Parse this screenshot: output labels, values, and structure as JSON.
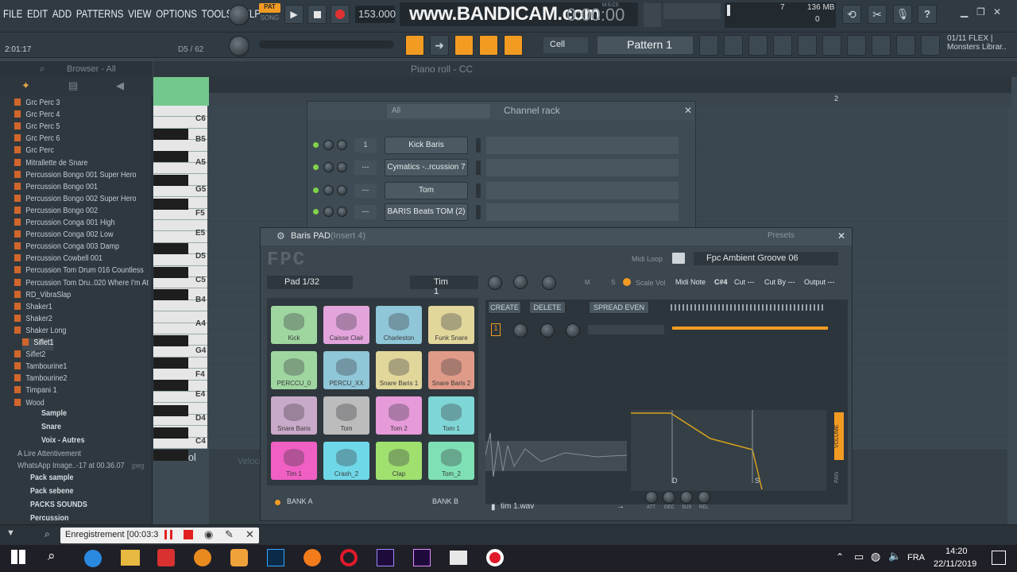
{
  "menu": [
    "FILE",
    "EDIT",
    "ADD",
    "PATTERNS",
    "VIEW",
    "OPTIONS",
    "TOOLS",
    "HELP"
  ],
  "transport": {
    "pat_label": "PAT",
    "song_label": "SONG",
    "tempo": "153.000",
    "time": "0:00:00",
    "mscs": "M:S:CS"
  },
  "watermark": "www.BANDICAM.com",
  "stats": {
    "cpu": "7",
    "mem": "136 MB",
    "poly": "0"
  },
  "hint": {
    "time": "2:01:17",
    "pos": "D5 / 62"
  },
  "toolbar": {
    "snap": "Cell",
    "pattern": "Pattern 1"
  },
  "news": {
    "line1": "01/11  FLEX |",
    "line2": "Monsters Librar.."
  },
  "browser": {
    "title": "Browser - All",
    "items": [
      "Grc Perc 3",
      "Grc Perc 4",
      "Grc Perc 5",
      "Grc Perc 6",
      "Grc Perc",
      "Mitrallette de Snare",
      "Percussion Bongo 001 Super Hero",
      "Percussion Bongo 001",
      "Percussion Bongo 002 Super Hero",
      "Percussion Bongo 002",
      "Percussion Conga 001 High",
      "Percussion Conga 002 Low",
      "Percussion Conga 003 Damp",
      "Percussion Cowbell 001",
      "Percussion Tom Drum 016 Countless",
      "Percussion Tom Dru..020 Where I'm At",
      "RD_VibraSlap",
      "Shaker1",
      "Shaker2",
      "Shaker Long",
      "Siflet1",
      "Siflet2",
      "Tambourine1",
      "Tambourine2",
      "Timpani 1",
      "Wood"
    ],
    "folders": [
      "Sample",
      "Snare",
      "Voix - Autres"
    ],
    "files": [
      "A Lire Attentivement",
      "WhatsApp Image..-17 at 00.36.07"
    ],
    "ext": "jpeg",
    "packs": [
      "Pack sample",
      "Pack sebene",
      "PACKS SOUNDS",
      "Percussion"
    ]
  },
  "pianoroll": {
    "title": "Piano roll - CC",
    "bar_marker": "2",
    "keys": [
      "C6",
      "B5",
      "A5",
      "G5",
      "F5",
      "E5",
      "D5",
      "C5",
      "B4",
      "A4",
      "G4",
      "F4",
      "E4",
      "D4",
      "C4"
    ],
    "control": "Control",
    "velocity": "Velocity"
  },
  "channelrack": {
    "title": "Channel rack",
    "filter": "All",
    "channels": [
      {
        "num": "1",
        "name": "Kick Baris"
      },
      {
        "num": "---",
        "name": "Cymatics -..rcussion 7"
      },
      {
        "num": "---",
        "name": "Tom"
      },
      {
        "num": "---",
        "name": "BARIS Beats TOM (2)"
      }
    ]
  },
  "fpc": {
    "title": "Baris PAD",
    "insert": "(Insert 4)",
    "presets": "Presets",
    "logo": "FPC",
    "midi_loop": "Midi Loop",
    "loop_name": "Fpc Ambient Groove 06",
    "pad_sel": "Pad 1/32",
    "layer_name": "Tim 1",
    "scale_vol": "Scale Vol",
    "m": "M",
    "s": "S",
    "midi_note_label": "Midi Note",
    "midi_note": "C#4",
    "cut_label": "Cut ---",
    "cutby_label": "Cut By ---",
    "output_label": "Output ---",
    "create": "CREATE",
    "delete": "DELETE",
    "spread": "SPREAD EVEN",
    "layer_num": "1",
    "volume": "VOLUME",
    "pan": "PAN",
    "env": [
      "ATT",
      "DEC",
      "SUS",
      "REL"
    ],
    "d_marker": "D",
    "s_marker": "S",
    "sample_file": "tim 1.wav",
    "bank_a": "BANK A",
    "bank_b": "BANK B",
    "pads": [
      {
        "name": "Kick",
        "color": "#9fd6a0"
      },
      {
        "name": "Caisse Clair",
        "color": "#e3a4dc"
      },
      {
        "name": "Charleston",
        "color": "#8fc6d8"
      },
      {
        "name": "Funk Snare",
        "color": "#e2d79b"
      },
      {
        "name": "PERCCU_0",
        "color": "#9fd6a0"
      },
      {
        "name": "PERCU_XX",
        "color": "#8fc6d8"
      },
      {
        "name": "Snare Baris 1",
        "color": "#e2d79b"
      },
      {
        "name": "Snare Baris 2",
        "color": "#e09b88"
      },
      {
        "name": "Snare Baris",
        "color": "#c9a9c9"
      },
      {
        "name": "Tom",
        "color": "#bcbcbc"
      },
      {
        "name": "Tom 2",
        "color": "#e79ad9"
      },
      {
        "name": "Tom 1",
        "color": "#7fd6d6"
      },
      {
        "name": "Tim 1",
        "color": "#f05fc3"
      },
      {
        "name": "Crash_2",
        "color": "#6fd8e8"
      },
      {
        "name": "Clap",
        "color": "#9fe06f"
      },
      {
        "name": "Tom_2",
        "color": "#7ee0b4"
      }
    ]
  },
  "status": {
    "recording": "Enregistrement [00:03:3"
  },
  "taskbar": {
    "lang": "FRA",
    "time": "14:20",
    "date": "22/11/2019"
  }
}
